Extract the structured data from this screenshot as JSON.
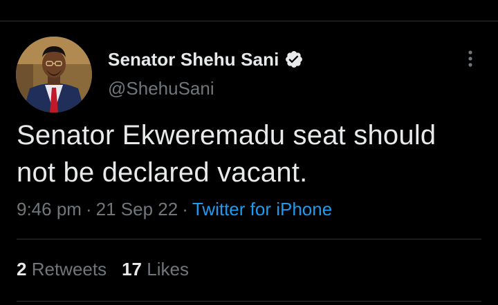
{
  "tweet": {
    "author": {
      "display_name": "Senator Shehu Sani",
      "handle": "@ShehuSani",
      "verified": true
    },
    "text_line_1": "Senator Ekweremadu seat should",
    "text_line_2": "not be declared vacant.",
    "time": "9:46 pm",
    "separator": "·",
    "date": "21 Sep 22",
    "source": "Twitter for iPhone",
    "stats": {
      "retweets_count": "2",
      "retweets_label": "Retweets",
      "likes_count": "17",
      "likes_label": "Likes"
    }
  },
  "icons": {
    "avatar": "avatar",
    "verified": "verified-badge-icon",
    "more": "more-options-icon"
  },
  "colors": {
    "background": "#000000",
    "primary_text": "#e7e9ea",
    "secondary_text": "#71767b",
    "link": "#1d9bf0",
    "divider": "#2f3336"
  }
}
